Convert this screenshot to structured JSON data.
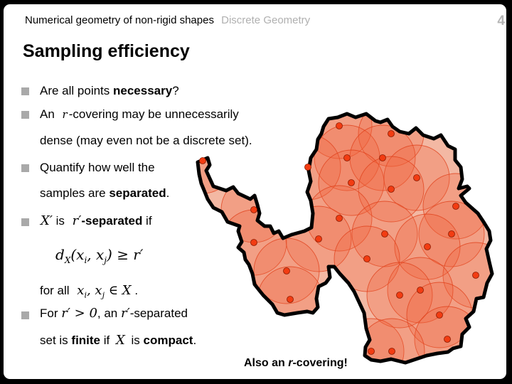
{
  "header": {
    "course": "Numerical geometry of non-rigid shapes",
    "section": "Discrete Geometry",
    "page_number": "4"
  },
  "title": "Sampling efficiency",
  "bullets": [
    {
      "pre": "Are all points ",
      "bold": "necessary",
      "post": "?"
    },
    {
      "pre": "An ",
      "math": "r",
      "post": "-covering may be unnecessarily",
      "line2": "dense (may even not be a discrete set)."
    },
    {
      "pre": "Quantify how well the",
      "line2_pre": "samples are ",
      "line2_bold": "separated",
      "line2_post": "."
    },
    {
      "math1": "X′",
      "mid": " is ",
      "math2": "r′",
      "bold": "-separated",
      "post": " if"
    },
    {
      "pre": "For ",
      "math1": "r′ > 0",
      "mid": ", an ",
      "math2": "r′",
      "post": "-separated",
      "line2_pre": "set is ",
      "line2_bold1": "finite",
      "line2_mid": " if ",
      "line2_math": "X",
      "line2_mid2": " is ",
      "line2_bold2": "compact",
      "line2_post": "."
    }
  ],
  "equation": {
    "d": "d",
    "d_sub": "X",
    "args": "(x",
    "i": "i",
    "comma": ", x",
    "j": "j",
    "rhs": ") ≥ r′"
  },
  "for_all": {
    "label": "for all ",
    "x": "x",
    "i": "i",
    "comma": ", x",
    "j": "j",
    "in": " ∈ X",
    "dot": " ."
  },
  "figure": {
    "description": "Antarctica map sampled with r′-separated points and covering circles",
    "caption_pre": "Also an ",
    "caption_italic": "r",
    "caption_post": "-covering!",
    "colors": {
      "land": "#f3b8a3",
      "circle_fill": "#f0603a",
      "circle_stroke": "#e0401a",
      "point_fill": "#f23c12",
      "point_stroke": "#8a1a00",
      "outline": "#000000"
    },
    "sample_count": 27
  }
}
